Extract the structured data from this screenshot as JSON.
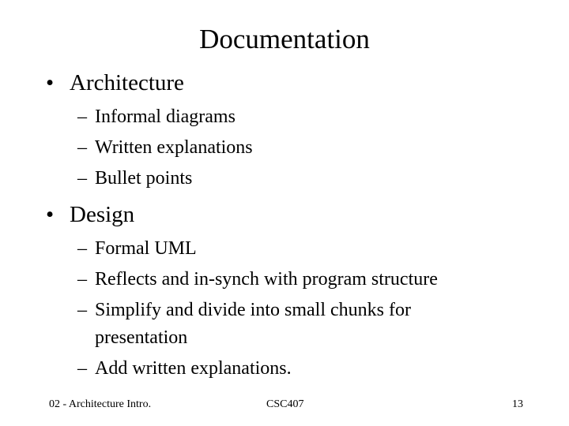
{
  "slide": {
    "title": "Documentation",
    "sections": [
      {
        "bullet": "•",
        "heading": "Architecture",
        "items": [
          "Informal diagrams",
          "Written explanations",
          "Bullet points"
        ]
      },
      {
        "bullet": "•",
        "heading": "Design",
        "items": [
          "Formal UML",
          "Reflects and in-synch with program structure",
          "Simplify and divide into small chunks for",
          "Add written explanations."
        ],
        "continuation": "presentation"
      }
    ],
    "dash": "–"
  },
  "footer": {
    "left": "02 - Architecture Intro.",
    "center": "CSC407",
    "right": "13"
  }
}
